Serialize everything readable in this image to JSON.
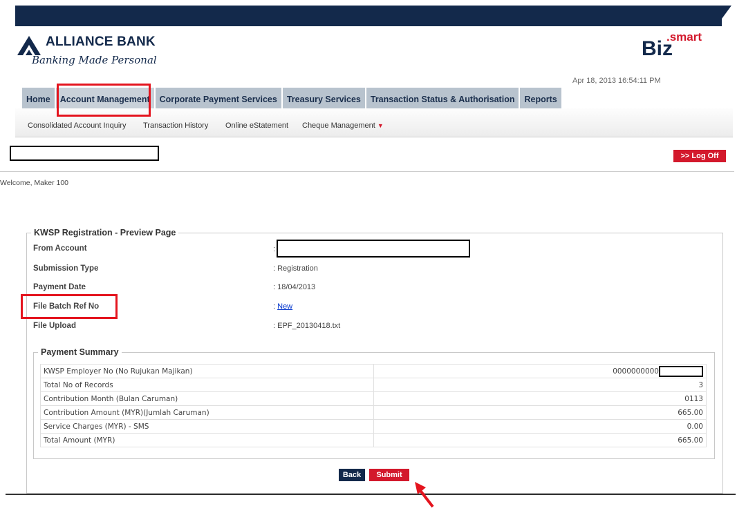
{
  "brand": {
    "name": "ALLIANCE BANK",
    "tagline": "Banking Made Personal",
    "product_big": "Biz",
    "product_small": ".smart"
  },
  "timestamp": "Apr 18, 2013 16:54:11 PM",
  "nav": {
    "tabs": [
      "Home",
      "Account Management",
      "Corporate Payment Services",
      "Treasury Services",
      "Transaction Status & Authorisation",
      "Reports"
    ],
    "active": "Account Management"
  },
  "subnav": {
    "items": [
      "Consolidated Account Inquiry",
      "Transaction History",
      "Online eStatement",
      "Cheque Management"
    ]
  },
  "logoff_label": ">> Log Off",
  "welcome": "Welcome, Maker 100",
  "preview": {
    "legend": "KWSP Registration - Preview Page",
    "fields": [
      {
        "label": "From Account",
        "value": ":"
      },
      {
        "label": "Submission Type",
        "value": ": Registration"
      },
      {
        "label": "Payment Date",
        "value": ": 18/04/2013"
      },
      {
        "label": "File Batch Ref No",
        "value_prefix": ": ",
        "value_link": "New"
      },
      {
        "label": "File Upload",
        "value": ": EPF_20130418.txt"
      }
    ]
  },
  "summary": {
    "legend": "Payment Summary",
    "rows": [
      {
        "label": "KWSP Employer No (No Rujukan Majikan)",
        "value": "0000000000"
      },
      {
        "label": "Total No of Records",
        "value": "3"
      },
      {
        "label": "Contribution Month (Bulan Caruman)",
        "value": "0113"
      },
      {
        "label": "Contribution Amount (MYR)(Jumlah Caruman)",
        "value": "665.00"
      },
      {
        "label": "Service Charges (MYR) - SMS",
        "value": "0.00"
      },
      {
        "label": "Total Amount (MYR)",
        "value": "665.00"
      }
    ]
  },
  "buttons": {
    "back": "Back",
    "submit": "Submit"
  },
  "colors": {
    "navy": "#13294b",
    "red": "#d3192c",
    "highlight": "#e4141e"
  }
}
